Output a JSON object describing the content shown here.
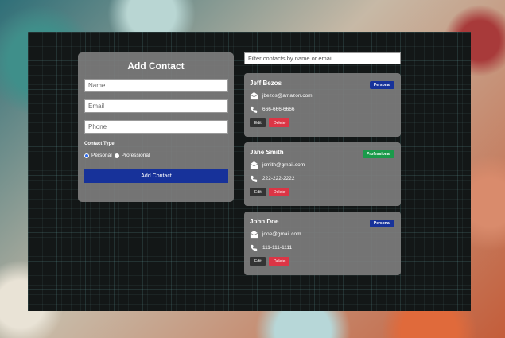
{
  "add_form": {
    "title": "Add Contact",
    "name_placeholder": "Name",
    "email_placeholder": "Email",
    "phone_placeholder": "Phone",
    "type_label": "Contact Type",
    "personal_label": "Personal",
    "professional_label": "Professional",
    "selected_type": "Personal",
    "submit_label": "Add Contact"
  },
  "filter": {
    "placeholder": "Filter contacts by name or email"
  },
  "contacts": [
    {
      "name": "Jeff Bezos",
      "email": "jbezos@amazon.com",
      "phone": "666-666-6666",
      "type": "Personal",
      "edit_label": "Edit",
      "delete_label": "Delete"
    },
    {
      "name": "Jane Smith",
      "email": "jsmith@gmail.com",
      "phone": "222-222-2222",
      "type": "Professional",
      "edit_label": "Edit",
      "delete_label": "Delete"
    },
    {
      "name": "John Doe",
      "email": "jdoe@gmail.com",
      "phone": "111-111-1111",
      "type": "Personal",
      "edit_label": "Edit",
      "delete_label": "Delete"
    }
  ],
  "colors": {
    "personal_badge": "#17329a",
    "professional_badge": "#1a9a4a",
    "delete_button": "#dc3545",
    "edit_button": "#333333"
  },
  "icons": {
    "email": "envelope-icon",
    "phone": "phone-icon"
  }
}
